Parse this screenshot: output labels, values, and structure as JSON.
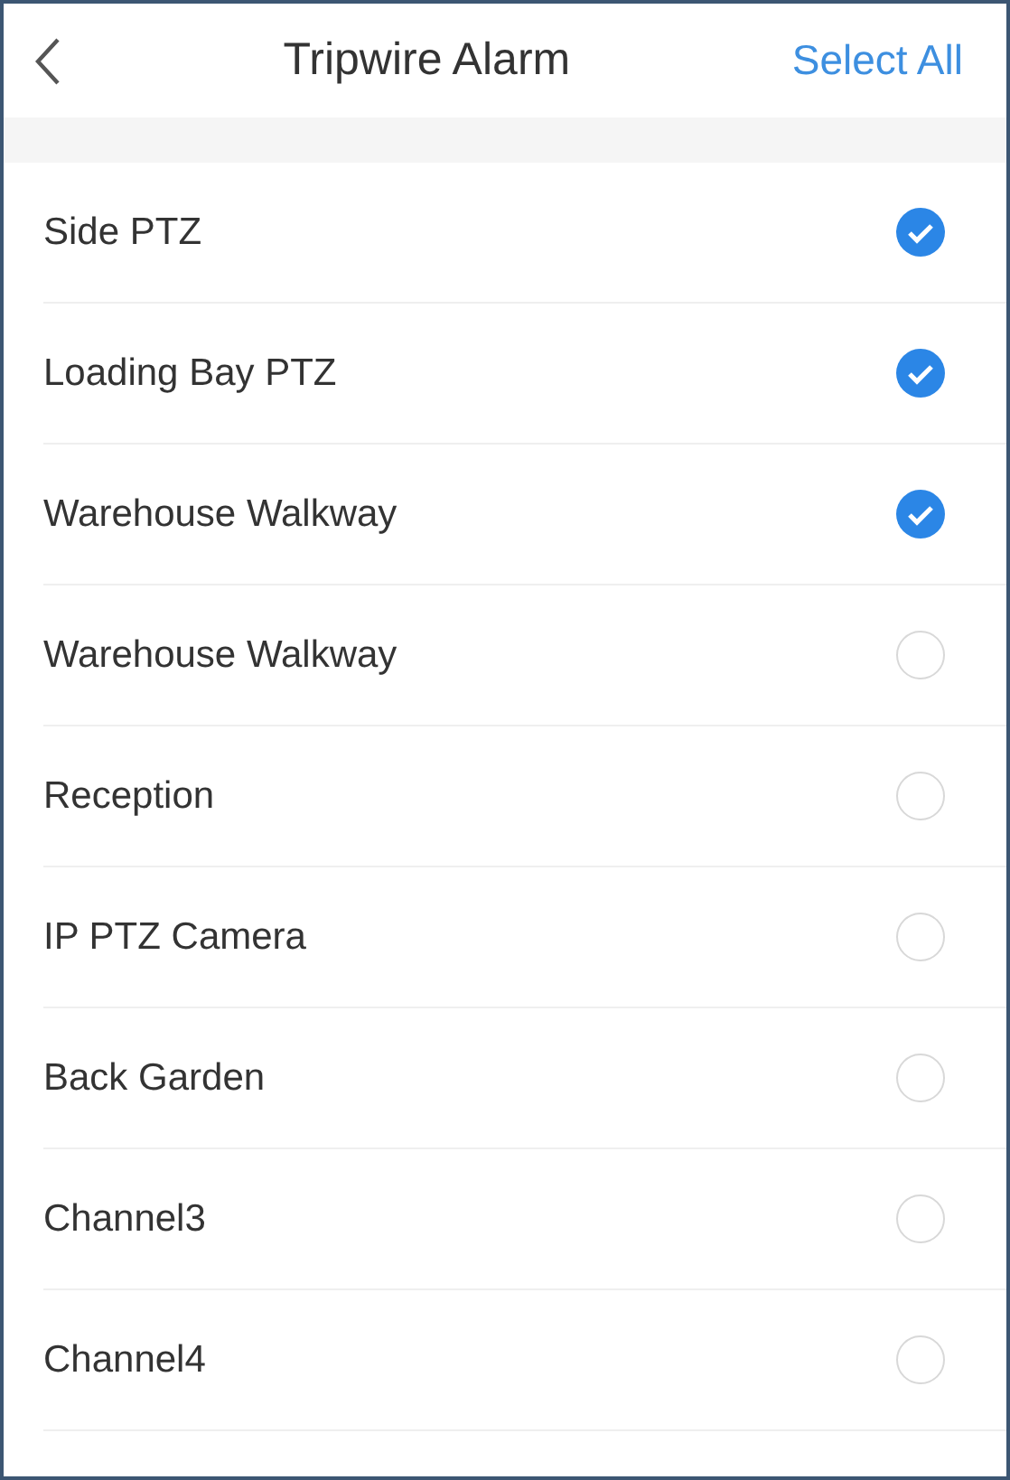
{
  "header": {
    "title": "Tripwire Alarm",
    "action": "Select All"
  },
  "channels": [
    {
      "name": "Side PTZ",
      "checked": true
    },
    {
      "name": "Loading Bay PTZ",
      "checked": true
    },
    {
      "name": "Warehouse Walkway",
      "checked": true
    },
    {
      "name": "Warehouse Walkway",
      "checked": false
    },
    {
      "name": "Reception",
      "checked": false
    },
    {
      "name": "IP PTZ Camera",
      "checked": false
    },
    {
      "name": "Back Garden",
      "checked": false
    },
    {
      "name": "Channel3",
      "checked": false
    },
    {
      "name": "Channel4",
      "checked": false
    }
  ]
}
